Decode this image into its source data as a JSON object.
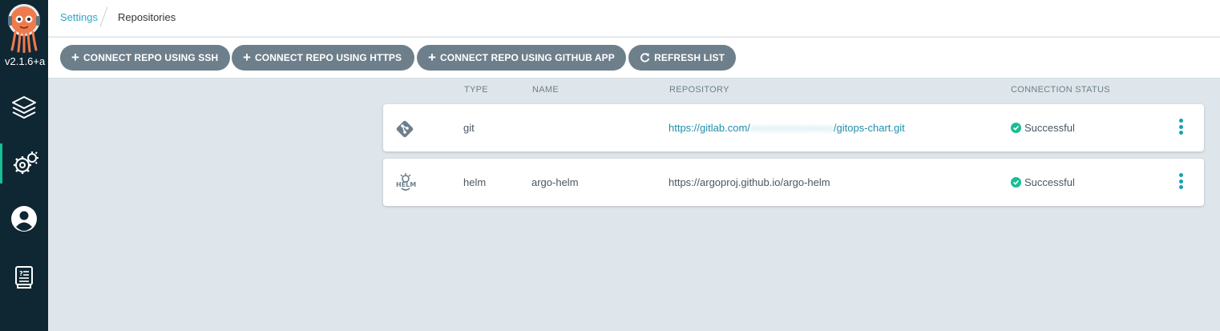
{
  "sidebar": {
    "version": "v2.1.6+a",
    "nav": [
      {
        "icon": "layers-icon"
      },
      {
        "icon": "gears-icon"
      },
      {
        "icon": "user-icon"
      },
      {
        "icon": "docs-icon"
      }
    ]
  },
  "breadcrumb": {
    "settings": "Settings",
    "current": "Repositories"
  },
  "toolbar": {
    "connect_ssh": "CONNECT REPO USING SSH",
    "connect_https": "CONNECT REPO USING HTTPS",
    "connect_github": "CONNECT REPO USING GITHUB APP",
    "refresh": "REFRESH LIST"
  },
  "table": {
    "headers": {
      "type": "TYPE",
      "name": "NAME",
      "repository": "REPOSITORY",
      "status": "CONNECTION STATUS"
    },
    "rows": [
      {
        "icon": "git-icon",
        "type": "git",
        "name": "",
        "repo_prefix": "https://gitlab.com/",
        "repo_hidden": "xxxxxxxxxxxxxxxx",
        "repo_suffix": "/gitops-chart.git",
        "status": "Successful"
      },
      {
        "icon": "helm-icon",
        "type": "helm",
        "name": "argo-helm",
        "repo": "https://argoproj.github.io/argo-helm",
        "status": "Successful"
      }
    ]
  },
  "colors": {
    "sidebar": "#0f2733",
    "accent": "#18be94",
    "link": "#1f8fab",
    "button": "#6d7f8b",
    "background": "#dee6eb"
  }
}
